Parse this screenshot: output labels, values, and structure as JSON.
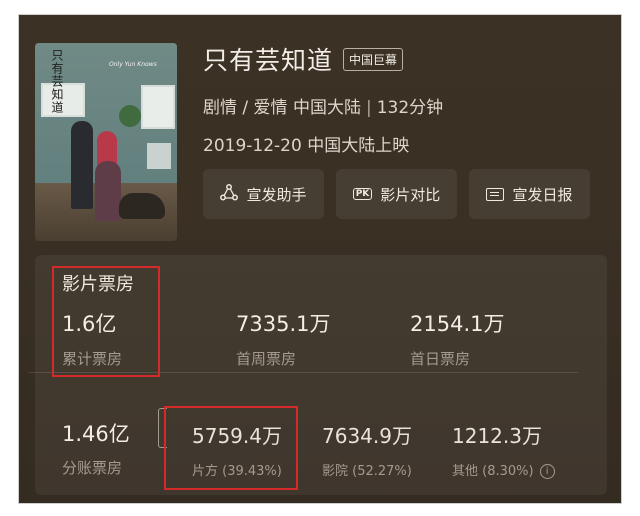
{
  "movie": {
    "title": "只有芸知道",
    "tag": "中国巨幕",
    "genre": "剧情 / 爱情",
    "region": "中国大陆",
    "separator": "|",
    "duration": "132分钟",
    "release": "2019-12-20 中国大陆上映",
    "poster_title": "只有芸知道",
    "poster_subtitle": "Only Yun Knows"
  },
  "actions": [
    {
      "label": "宣发助手",
      "icon": "share-triangle-icon"
    },
    {
      "label": "影片对比",
      "icon": "pk-icon",
      "badge": "PK"
    },
    {
      "label": "宣发日报",
      "icon": "report-card-icon"
    }
  ],
  "box_office": {
    "section_title": "影片票房",
    "total": {
      "value": "1.6亿",
      "label": "累计票房"
    },
    "first_week": {
      "value": "7335.1万",
      "label": "首周票房"
    },
    "first_day": {
      "value": "2154.1万",
      "label": "首日票房"
    },
    "split": {
      "value": "1.46亿",
      "label": "分账票房"
    },
    "producer": {
      "value": "5759.4万",
      "label": "片方 (39.43%)"
    },
    "cinema": {
      "value": "7634.9万",
      "label": "影院 (52.27%)"
    },
    "other": {
      "value": "1212.3万",
      "label": "其他 (8.30%)"
    },
    "info_icon_glyph": "i"
  },
  "colors": {
    "background": "#3a3024",
    "highlight_box": "#d52a2a",
    "primary_text": "#f3eee6",
    "secondary_text": "#a39b8f"
  }
}
